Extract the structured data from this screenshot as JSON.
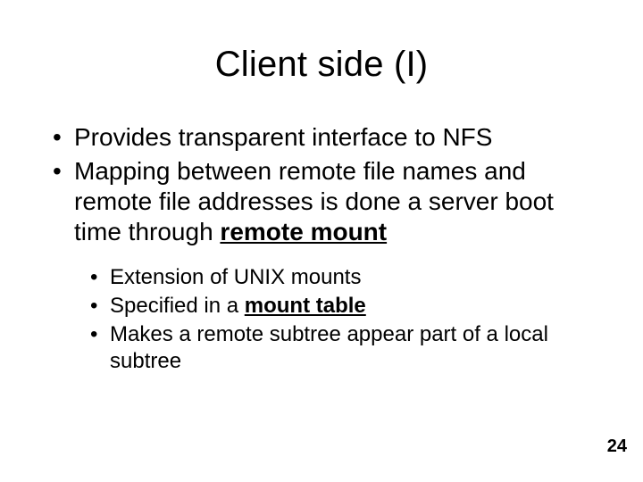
{
  "title": "Client side (I)",
  "bullets": [
    {
      "pre": "Provides transparent interface to NFS",
      "bold": "",
      "post": ""
    },
    {
      "pre": "Mapping between remote file names and remote file addresses is done a server boot time through ",
      "bold": "remote mount",
      "post": ""
    }
  ],
  "subbullets": [
    {
      "pre": "Extension of UNIX mounts",
      "bold": "",
      "post": ""
    },
    {
      "pre": "Specified in a ",
      "bold": "mount table",
      "post": ""
    },
    {
      "pre": "Makes a remote subtree appear part of a local subtree",
      "bold": "",
      "post": ""
    }
  ],
  "page_number": "24"
}
